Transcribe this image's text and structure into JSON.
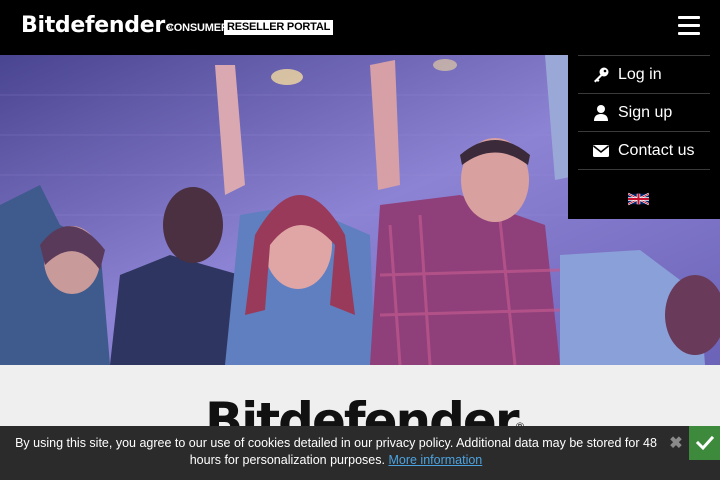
{
  "header": {
    "brand": "Bitdefender",
    "registered": "®",
    "consumer": "CONSUMER",
    "portal": "RESELLER PORTAL",
    "menu_icon": "hamburger-menu-icon"
  },
  "menu": {
    "items": [
      {
        "label": "Log in",
        "icon": "key-icon"
      },
      {
        "label": "Sign up",
        "icon": "user-icon"
      },
      {
        "label": "Contact us",
        "icon": "envelope-icon"
      }
    ],
    "language_flag": "uk-flag-icon"
  },
  "content": {
    "logo": "Bitdefender",
    "registered": "®"
  },
  "cookie": {
    "text": "By using this site, you agree to our use of cookies detailed in our privacy policy. Additional data may be stored for 48 hours for personalization purposes.",
    "link": "More information",
    "close_icon": "close-icon",
    "accept_icon": "checkmark-icon"
  },
  "colors": {
    "header_bg": "#000000",
    "cookie_bg": "#2b2b2b",
    "link": "#4ca3e0",
    "accept": "#3d8a3d",
    "hero_tint": "#7c6fc4"
  }
}
